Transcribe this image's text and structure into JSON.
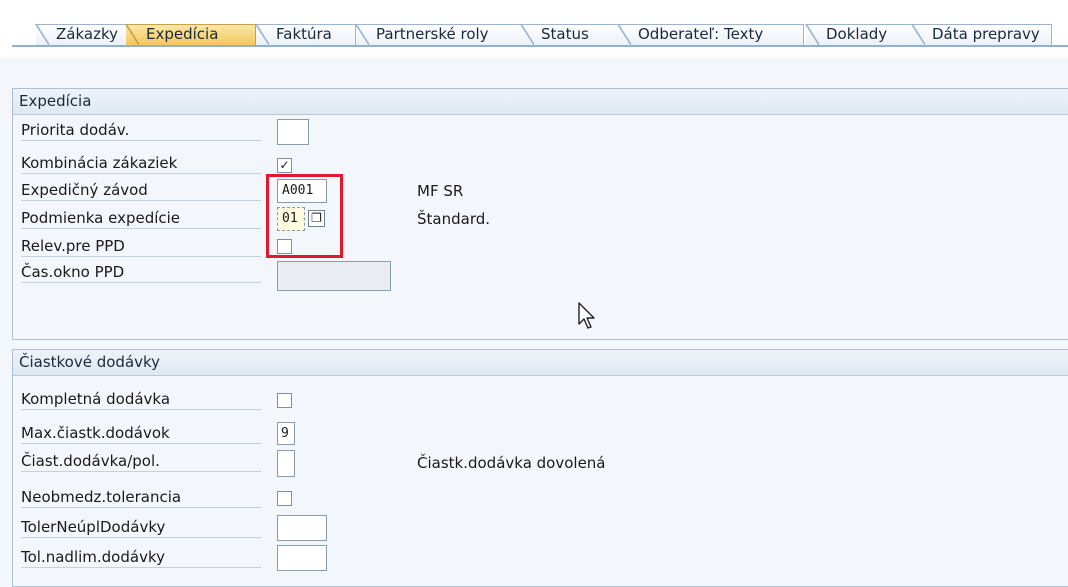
{
  "tabs": [
    "Zákazky",
    "Expedícia",
    "Faktúra",
    "Partnerské roly",
    "Status",
    "Odberateľ: Texty",
    "Doklady",
    "Dáta prepravy"
  ],
  "active_tab": "Expedícia",
  "shipping": {
    "title": "Expedícia",
    "priority_label": "Priorita dodáv.",
    "priority_value": "",
    "order_combination_label": "Kombinácia zákaziek",
    "order_combination_checked": "✓",
    "plant_label": "Expedičný závod",
    "plant_value": "A001",
    "plant_desc": "MF SR",
    "condition_label": "Podmienka expedície",
    "condition_value": "01",
    "condition_desc": "Štandard.",
    "ppd_relevant_label": "Relev.pre PPD",
    "ppd_window_label": "Čas.okno PPD",
    "ppd_window_value": ""
  },
  "partial": {
    "title": "Čiastkové dodávky",
    "complete_label": "Kompletná dodávka",
    "max_label": "Max.čiastk.dodávok",
    "max_value": "9",
    "per_item_label": "Čiast.dodávka/pol.",
    "per_item_value": "",
    "per_item_desc": "Čiastk.dodávka dovolená",
    "unlimited_label": "Neobmedz.tolerancia",
    "under_label": "TolerNeúplDodávky",
    "under_value": "",
    "over_label": "Tol.nadlim.dodávky",
    "over_value": ""
  },
  "icons": {
    "f4_help": "value-help-icon",
    "cursor": "mouse-pointer-icon"
  },
  "colors": {
    "highlight": "#e0192b",
    "active_tab": "#f2c85b"
  }
}
